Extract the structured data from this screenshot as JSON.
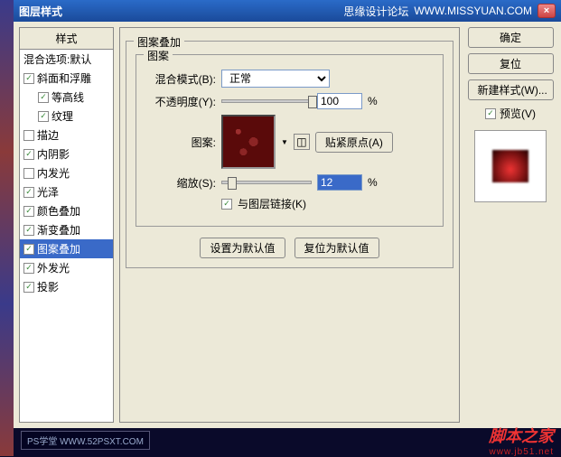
{
  "title": "图层样式",
  "titleRight": "思缘设计论坛",
  "titleUrl": "WWW.MISSYUAN.COM",
  "sidebar": {
    "header": "样式",
    "blend": "混合选项:默认",
    "items": [
      {
        "label": "斜面和浮雕",
        "on": true
      },
      {
        "label": "等高线",
        "on": true,
        "indent": true
      },
      {
        "label": "纹理",
        "on": true,
        "indent": true
      },
      {
        "label": "描边",
        "on": false
      },
      {
        "label": "内阴影",
        "on": true
      },
      {
        "label": "内发光",
        "on": false
      },
      {
        "label": "光泽",
        "on": true
      },
      {
        "label": "颜色叠加",
        "on": true
      },
      {
        "label": "渐变叠加",
        "on": true
      },
      {
        "label": "图案叠加",
        "on": true,
        "sel": true
      },
      {
        "label": "外发光",
        "on": true
      },
      {
        "label": "投影",
        "on": true
      }
    ]
  },
  "main": {
    "groupTitle": "图案叠加",
    "innerTitle": "图案",
    "blendMode": {
      "label": "混合模式(B):",
      "value": "正常"
    },
    "opacity": {
      "label": "不透明度(Y):",
      "value": "100",
      "unit": "%"
    },
    "pattern": {
      "label": "图案:"
    },
    "snap": "贴紧原点(A)",
    "scale": {
      "label": "缩放(S):",
      "value": "12",
      "unit": "%"
    },
    "link": "与图层链接(K)",
    "setDefault": "设置为默认值",
    "resetDefault": "复位为默认值"
  },
  "right": {
    "ok": "确定",
    "cancel": "复位",
    "newStyle": "新建样式(W)...",
    "preview": "预览(V)"
  },
  "wm": {
    "ps": "PS学堂  WWW.52PSXT.COM",
    "jb": "脚本之家",
    "jben": "www.jb51.net"
  }
}
